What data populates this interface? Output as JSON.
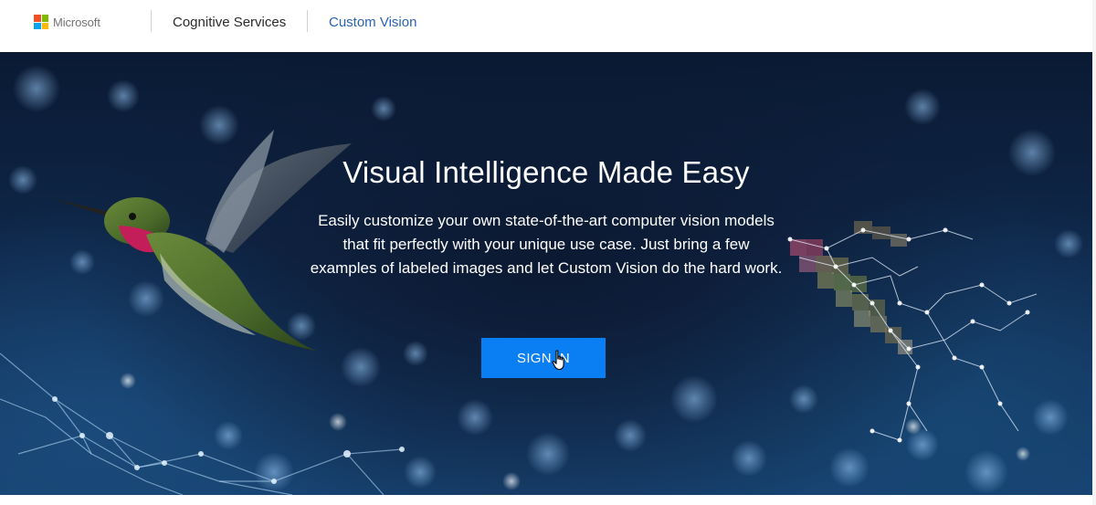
{
  "header": {
    "brand": "Microsoft",
    "brand_colors": [
      "#f25022",
      "#7fba00",
      "#00a4ef",
      "#ffb900"
    ],
    "nav": {
      "cognitive_services": "Cognitive Services",
      "custom_vision": "Custom Vision"
    }
  },
  "hero": {
    "title": "Visual Intelligence Made Easy",
    "description": "Easily customize your own state-of-the-art computer vision models that fit perfectly with your unique use case. Just bring a few examples of labeled images and let Custom Vision do the hard work.",
    "sign_in_label": "SIGN IN",
    "accent_color": "#0a7ff3"
  },
  "icons": {
    "logo": "microsoft-logo-icon",
    "cursor": "hand-pointer-icon"
  }
}
